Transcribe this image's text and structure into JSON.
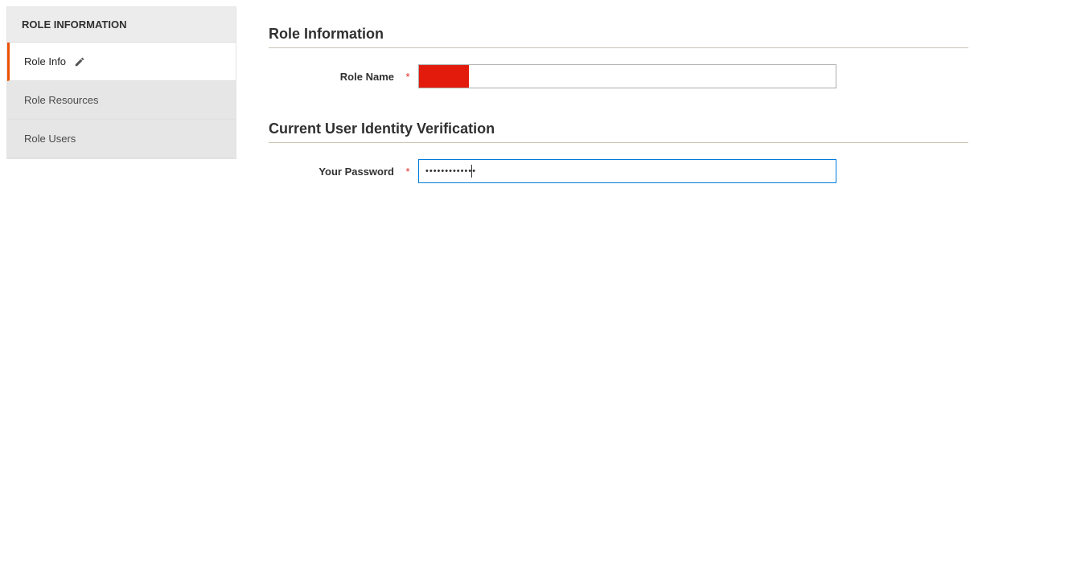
{
  "sidebar": {
    "title": "ROLE INFORMATION",
    "tabs": [
      {
        "label": "Role Info",
        "active": true,
        "has_edit_icon": true
      },
      {
        "label": "Role Resources",
        "active": false,
        "has_edit_icon": false
      },
      {
        "label": "Role Users",
        "active": false,
        "has_edit_icon": false
      }
    ]
  },
  "sections": {
    "role_information": {
      "title": "Role Information",
      "field_label": "Role Name",
      "required": "*",
      "value": ""
    },
    "identity_verification": {
      "title": "Current User Identity Verification",
      "field_label": "Your Password",
      "required": "*",
      "value": "•••••••••••••"
    }
  },
  "colors": {
    "accent": "#eb5202",
    "focus_border": "#007bdb",
    "required": "#e02b27",
    "highlight_fill": "#e31b0c"
  }
}
